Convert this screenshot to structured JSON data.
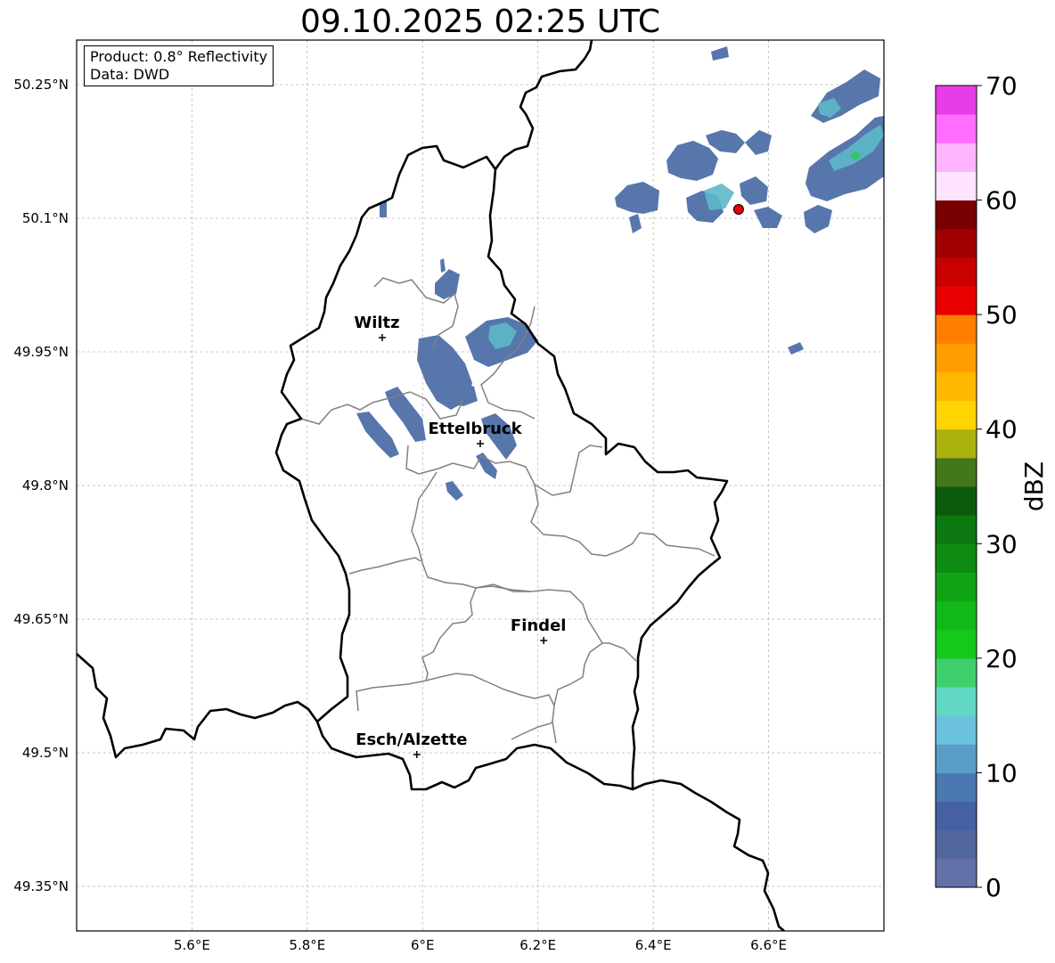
{
  "title": "09.10.2025 02:25 UTC",
  "info": {
    "product": "Product: 0.8° Reflectivity",
    "data": "Data: DWD"
  },
  "map": {
    "lon_range": [
      5.4,
      6.8
    ],
    "lat_range": [
      49.3,
      50.3
    ],
    "lat_ticks": [
      "50.25°N",
      "50.1°N",
      "49.95°N",
      "49.8°N",
      "49.65°N",
      "49.5°N",
      "49.35°N"
    ],
    "lon_ticks": [
      "5.6°E",
      "5.8°E",
      "6°E",
      "6.2°E",
      "6.4°E",
      "6.6°E"
    ],
    "gridlines": true,
    "cities": [
      {
        "name": "Wiltz",
        "lon": 5.93,
        "lat": 49.966
      },
      {
        "name": "Ettelbruck",
        "lon": 6.1,
        "lat": 49.847
      },
      {
        "name": "Findel",
        "lon": 6.21,
        "lat": 49.626
      },
      {
        "name": "Esch/Alzette",
        "lon": 5.99,
        "lat": 49.498
      }
    ],
    "radar_site": {
      "lon": 6.548,
      "lat": 50.11,
      "color": "#e8000b"
    }
  },
  "colorbar": {
    "label": "dBZ",
    "ticks": [
      "0",
      "10",
      "20",
      "30",
      "40",
      "50",
      "60",
      "70"
    ],
    "range": [
      0,
      70
    ],
    "colors": [
      "#6471a8",
      "#52679e",
      "#4561a3",
      "#4a78b0",
      "#5a9ec8",
      "#6bc2dc",
      "#60d8c2",
      "#3ed06c",
      "#14c81c",
      "#12b81a",
      "#10a414",
      "#0e8c12",
      "#0c7810",
      "#0a5c0c",
      "#44761a",
      "#aab20e",
      "#ffd400",
      "#ffb800",
      "#ff9c00",
      "#ff7e00",
      "#e80000",
      "#c80000",
      "#a00000",
      "#780000",
      "#ffe4ff",
      "#ffb4ff",
      "#ff6eff",
      "#e83ce8"
    ]
  }
}
